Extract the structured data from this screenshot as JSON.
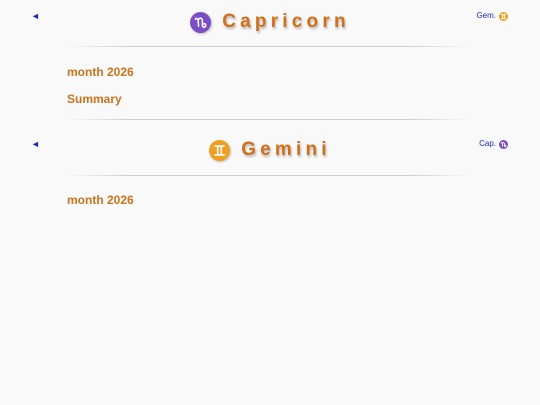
{
  "sections": [
    {
      "back_arrow": "◄",
      "sign_name": "Capricorn",
      "sign_icon": "capricorn-glyph-icon",
      "badge_color": "#7a4fc6",
      "next_label": "Gem.",
      "next_icon": "gemini-glyph-icon",
      "next_badge_color": "#f0a020",
      "headings": [
        "month 2026",
        "Summary"
      ]
    },
    {
      "back_arrow": "◄",
      "sign_name": "Gemini",
      "sign_icon": "gemini-glyph-icon",
      "badge_color": "#f0a020",
      "next_label": "Cap.",
      "next_icon": "capricorn-glyph-icon",
      "next_badge_color": "#7a4fc6",
      "headings": [
        "month 2026"
      ]
    }
  ],
  "colors": {
    "title": "#d2701a",
    "heading": "#c9741c",
    "link": "#1e2ab8",
    "background": "#f9f9f9"
  }
}
